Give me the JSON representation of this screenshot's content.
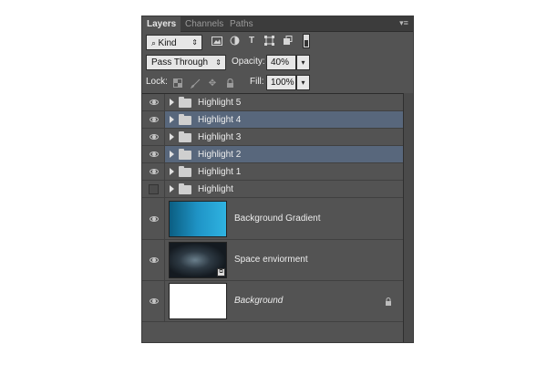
{
  "tabs": [
    {
      "label": "Layers",
      "active": true
    },
    {
      "label": "Channels",
      "active": false
    },
    {
      "label": "Paths",
      "active": false
    }
  ],
  "filter": {
    "kind_label": "Kind",
    "icons": [
      "pixel-filter-icon",
      "adjustment-filter-icon",
      "type-filter-icon",
      "shape-filter-icon",
      "smart-object-filter-icon"
    ]
  },
  "blend": {
    "mode": "Pass Through",
    "opacity_label": "Opacity:",
    "opacity_value": "40%"
  },
  "lock": {
    "label": "Lock:",
    "fill_label": "Fill:",
    "fill_value": "100%"
  },
  "layers": [
    {
      "name": "Highlight 5",
      "type": "group",
      "visible": true,
      "selected": false
    },
    {
      "name": "Highlight 4",
      "type": "group",
      "visible": true,
      "selected": true
    },
    {
      "name": "Highlight 3",
      "type": "group",
      "visible": true,
      "selected": false
    },
    {
      "name": "Highlight 2",
      "type": "group",
      "visible": true,
      "selected": true
    },
    {
      "name": "Highlight 1",
      "type": "group",
      "visible": true,
      "selected": false
    },
    {
      "name": "Highlight",
      "type": "group",
      "visible": false,
      "selected": false
    },
    {
      "name": "Background Gradient",
      "type": "image",
      "visible": true,
      "selected": false
    },
    {
      "name": "Space enviorment",
      "type": "smart-object",
      "visible": true,
      "selected": false
    },
    {
      "name": "Background",
      "type": "background",
      "visible": true,
      "selected": false,
      "locked": true
    }
  ],
  "colors": {
    "panel_bg": "#535353",
    "selected_row": "#58677c",
    "tab_bar": "#3c3c3c"
  }
}
